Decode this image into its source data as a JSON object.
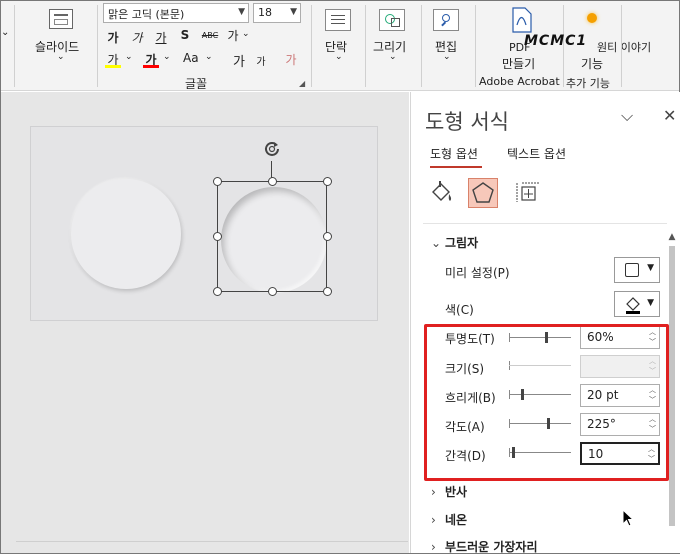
{
  "ribbon": {
    "slides_group": {
      "label": "슬라이드"
    },
    "font": {
      "family": "맑은 고딕 (본문)",
      "size": "18",
      "group_label": "글꼴",
      "bold": "가",
      "italic": "가",
      "underline": "가",
      "strike": "S",
      "char_spacing": "가",
      "grow": "가",
      "shrink": "가",
      "case": "Aa",
      "highlight": "가",
      "color": "가",
      "clear": "가",
      "spacing_label": "ABC"
    },
    "paragraph": {
      "label": "단락"
    },
    "drawing": {
      "label": "그리기"
    },
    "editing": {
      "label": "편집"
    },
    "acrobat": {
      "pdf_label_line1": "PDF",
      "pdf_label_line2": "만들기",
      "group_label": "Adobe Acrobat"
    },
    "addin": {
      "label_line1": "원티 이야기",
      "label_line2": "기능",
      "group_label": "추가 기능"
    },
    "watermark": "MCMC1",
    "colors": {
      "highlight": "#ffff00",
      "font_color": "#ff0000",
      "accent": "#c0392b"
    }
  },
  "pane": {
    "title": "도형 서식",
    "tabs": [
      "도형 옵션",
      "텍스트 옵션"
    ],
    "icons": [
      "fill-line-icon",
      "effects-icon",
      "size-properties-icon"
    ],
    "shadow_section": {
      "heading": "그림자",
      "preset_label": "미리 설정(P)",
      "color_label": "색(C)",
      "fields": [
        {
          "label": "투명도(T)",
          "value": "60%",
          "slider": 0.6,
          "disabled": false,
          "focus": false
        },
        {
          "label": "크기(S)",
          "value": "",
          "slider": 0.0,
          "disabled": true,
          "focus": false
        },
        {
          "label": "흐리게(B)",
          "value": "20 pt",
          "slider": 0.2,
          "disabled": false,
          "focus": false
        },
        {
          "label": "각도(A)",
          "value": "225°",
          "slider": 0.625,
          "disabled": false,
          "focus": false
        },
        {
          "label": "간격(D)",
          "value": "10",
          "slider": 0.05,
          "disabled": false,
          "focus": true
        }
      ]
    },
    "collapsed_sections": [
      "반사",
      "네온",
      "부드러운 가장자리"
    ]
  }
}
